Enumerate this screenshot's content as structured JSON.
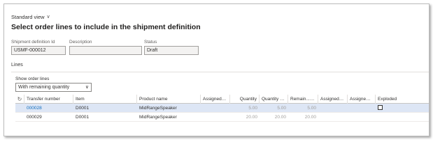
{
  "header": {
    "view_label": "Standard view",
    "title": "Select order lines to include in the shipment definition"
  },
  "fields": {
    "shipment_definition_id": {
      "label": "Shipment definition Id",
      "value": "USMF-000012"
    },
    "description": {
      "label": "Description",
      "value": ""
    },
    "status": {
      "label": "Status",
      "value": "Draft"
    }
  },
  "lines": {
    "section_title": "Lines",
    "filter_label": "Show order lines",
    "filter_value": "With remaining quantity"
  },
  "grid": {
    "columns": [
      "Transfer number",
      "Item",
      "Product name",
      "Assigned q...",
      "Quantity",
      "Quantity a...",
      "Remain...",
      "Assigned t...",
      "Assigned t...",
      "Exploded"
    ],
    "rows": [
      {
        "transfer_number": "000028",
        "item": "D0001",
        "product_name": "MidRangeSpeaker",
        "assigned_q": "",
        "quantity": "5.00",
        "quantity_a": "5.00",
        "remaining": "5.00",
        "assigned_t1": "",
        "assigned_t2": "",
        "exploded": "",
        "selected": true
      },
      {
        "transfer_number": "000029",
        "item": "D0001",
        "product_name": "MidRangeSpeaker",
        "assigned_q": "",
        "quantity": "20.00",
        "quantity_a": "20.00",
        "remaining": "20.00",
        "assigned_t1": "",
        "assigned_t2": "",
        "exploded": "",
        "selected": false
      }
    ]
  },
  "icons": {
    "view_chevron": "chevron-down-icon",
    "refresh": "refresh-icon",
    "filter": "filter-icon",
    "dropdown": "chevron-down-icon",
    "checkbox": "checkbox-icon"
  },
  "colors": {
    "link": "#0f6cbd",
    "selected_row": "#dde6f5",
    "field_bg": "#f3f2f1"
  }
}
